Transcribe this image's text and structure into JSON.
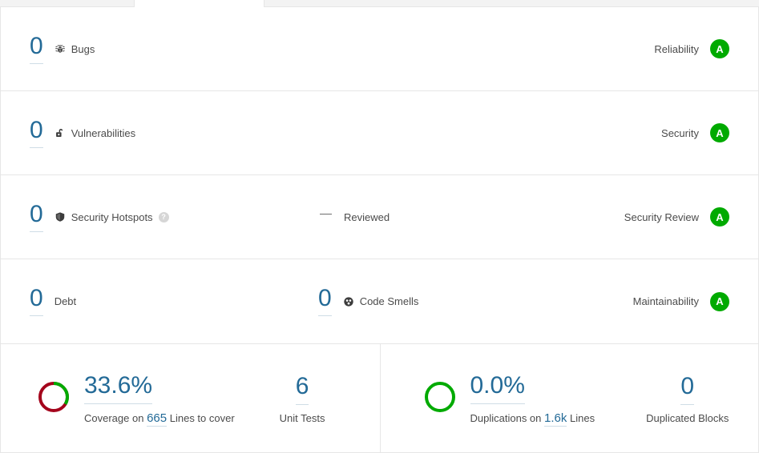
{
  "tabs": {
    "active_tab_visible": true
  },
  "measures": {
    "rows": [
      {
        "value": "0",
        "label": "Bugs",
        "icon": "bug-icon",
        "rating_label": "Reliability",
        "rating_grade": "A",
        "rating_color": "#00aa00",
        "secondary_value": "",
        "secondary_label": "",
        "has_help": false
      },
      {
        "value": "0",
        "label": "Vulnerabilities",
        "icon": "open-lock-icon",
        "rating_label": "Security",
        "rating_grade": "A",
        "rating_color": "#00aa00",
        "secondary_value": "",
        "secondary_label": "",
        "has_help": false
      },
      {
        "value": "0",
        "label": "Security Hotspots",
        "icon": "shield-icon",
        "rating_label": "Security Review",
        "rating_grade": "A",
        "rating_color": "#00aa00",
        "secondary_value": "—",
        "secondary_label": "Reviewed",
        "has_help": true,
        "help_glyph": "?"
      },
      {
        "value": "0",
        "label": "Debt",
        "icon": "none",
        "rating_label": "Maintainability",
        "rating_grade": "A",
        "rating_color": "#00aa00",
        "secondary_value": "0",
        "secondary_label": "Code Smells",
        "secondary_icon": "code-smell-icon",
        "has_help": false
      }
    ]
  },
  "coverage": {
    "percent_text": "33.6%",
    "percent_value": 33.6,
    "caption_prefix": "Coverage on",
    "lines_value": "665",
    "caption_suffix": "Lines to cover",
    "donut_covered_color": "#00aa00",
    "donut_uncovered_color": "#a4041c",
    "unit_tests_value": "6",
    "unit_tests_label": "Unit Tests"
  },
  "duplications": {
    "percent_text": "0.0%",
    "percent_value": 0.0,
    "caption_prefix": "Duplications on",
    "lines_value": "1.6k",
    "caption_suffix": "Lines",
    "donut_color": "#00aa00",
    "blocks_value": "0",
    "blocks_label": "Duplicated Blocks"
  }
}
